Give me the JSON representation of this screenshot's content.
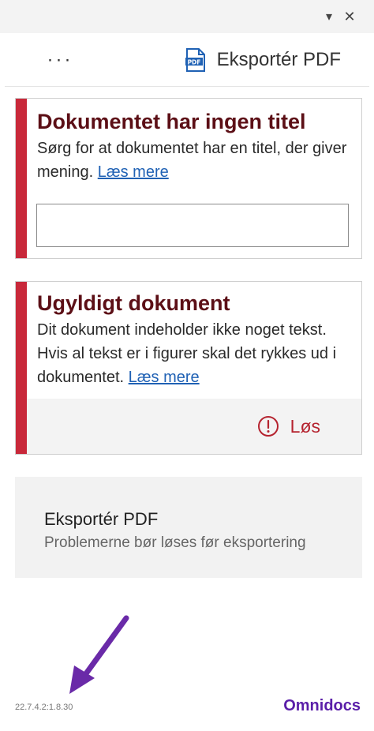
{
  "window": {
    "dropdown_glyph": "▾",
    "close_glyph": "✕"
  },
  "toolbar": {
    "more_glyph": "···",
    "export_label": "Eksportér PDF",
    "export_icon": "pdf-file-icon",
    "export_icon_text": "PDF"
  },
  "issues": [
    {
      "title": "Dokumentet har ingen titel",
      "description": "Sørg for at dokumentet har en titel, der giver mening.",
      "link": "Læs mere",
      "input_value": "",
      "input_placeholder": ""
    },
    {
      "title": "Ugyldigt dokument",
      "description": "Dit dokument indeholder ikke noget tekst. Hvis al tekst er i figurer skal det rykkes ud i dokumentet.",
      "link": "Læs mere",
      "fix_label": "Løs",
      "fix_icon": "alert-circle-icon"
    }
  ],
  "export_panel": {
    "title": "Eksportér PDF",
    "subtitle": "Problemerne bør løses før eksportering"
  },
  "footer": {
    "version": "22.7.4.2:1.8.30",
    "brand": "Omnidocs"
  },
  "colors": {
    "accent": "#c8283a",
    "title": "#5c0f16",
    "link": "#1f61b4",
    "brand": "#5a1ea8",
    "arrow": "#6a2aa8"
  }
}
